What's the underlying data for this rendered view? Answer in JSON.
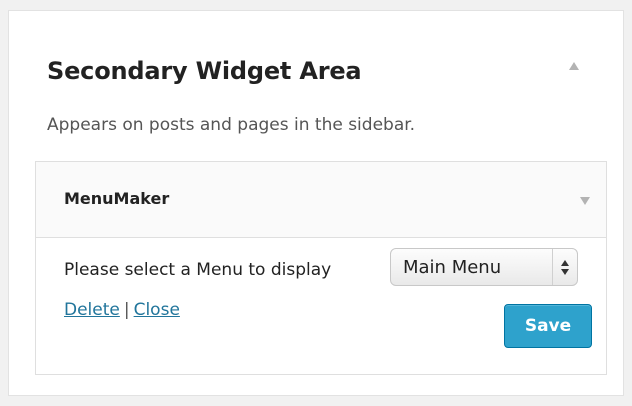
{
  "area": {
    "title": "Secondary Widget Area",
    "description": "Appears on posts and pages in the sidebar.",
    "collapse_icon": "triangle-up-icon"
  },
  "widget": {
    "title": "MenuMaker",
    "toggle_icon": "triangle-down-icon",
    "select_label": "Please select a Menu to display",
    "menu_select": {
      "selected": "Main Menu"
    },
    "delete_label": "Delete",
    "separator": "|",
    "close_label": "Close",
    "save_label": "Save"
  },
  "colors": {
    "link": "#21759b",
    "save_button": "#2ea2cc",
    "background": "#f1f1f1"
  }
}
